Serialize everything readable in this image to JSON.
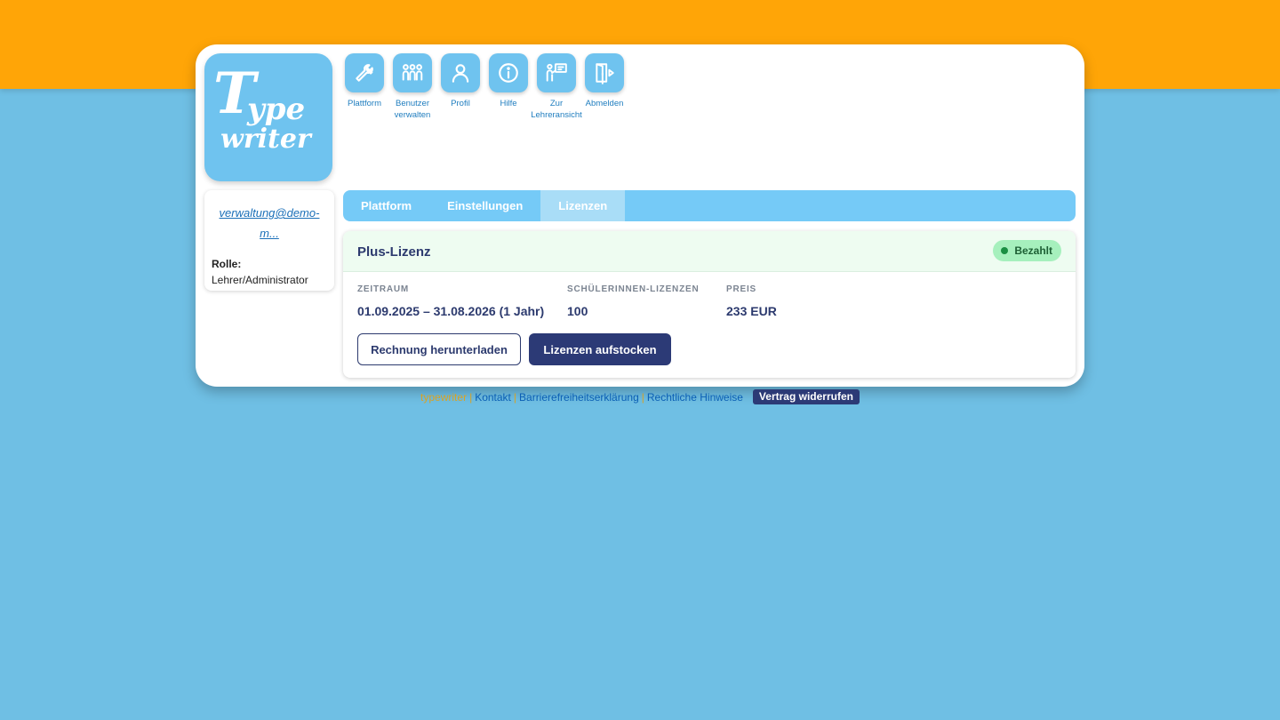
{
  "logo": {
    "line1": "Type",
    "line2": "writer"
  },
  "nav": [
    {
      "label": "Plattform",
      "icon": "wrench-icon"
    },
    {
      "label": "Benutzer verwalten",
      "icon": "users-icon"
    },
    {
      "label": "Profil",
      "icon": "person-icon"
    },
    {
      "label": "Hilfe",
      "icon": "info-icon"
    },
    {
      "label": "Zur Lehreransicht",
      "icon": "teacher-board-icon"
    },
    {
      "label": "Abmelden",
      "icon": "logout-icon"
    }
  ],
  "user": {
    "email": "verwaltung@demo-m...",
    "role_label": "Rolle:",
    "role": "Lehrer/Administrator"
  },
  "tabs": [
    {
      "label": "Plattform",
      "active": false
    },
    {
      "label": "Einstellungen",
      "active": false
    },
    {
      "label": "Lizenzen",
      "active": true
    }
  ],
  "license": {
    "title": "Plus-Lizenz",
    "status": "Bezahlt",
    "fields": [
      {
        "label": "ZEITRAUM",
        "value": "01.09.2025 – 31.08.2026 (1 Jahr)"
      },
      {
        "label": "SCHÜLERINNEN-LIZENZEN",
        "value": "100"
      },
      {
        "label": "PREIS",
        "value": "233 EUR"
      }
    ],
    "download_button": "Rechnung herunterladen",
    "upgrade_button": "Lizenzen aufstocken"
  },
  "footer": {
    "brand": "typewriter",
    "links": [
      "Kontakt",
      "Barrierefreiheitserklärung",
      "Rechtliche Hinweise"
    ],
    "revoke": "Vertrag widerrufen"
  },
  "colors": {
    "top_band": "#ffa507",
    "background": "#6fbfe4",
    "accent": "#6fc3ef",
    "primary_dark": "#2c3a76",
    "status_green": "#1a8f43"
  }
}
